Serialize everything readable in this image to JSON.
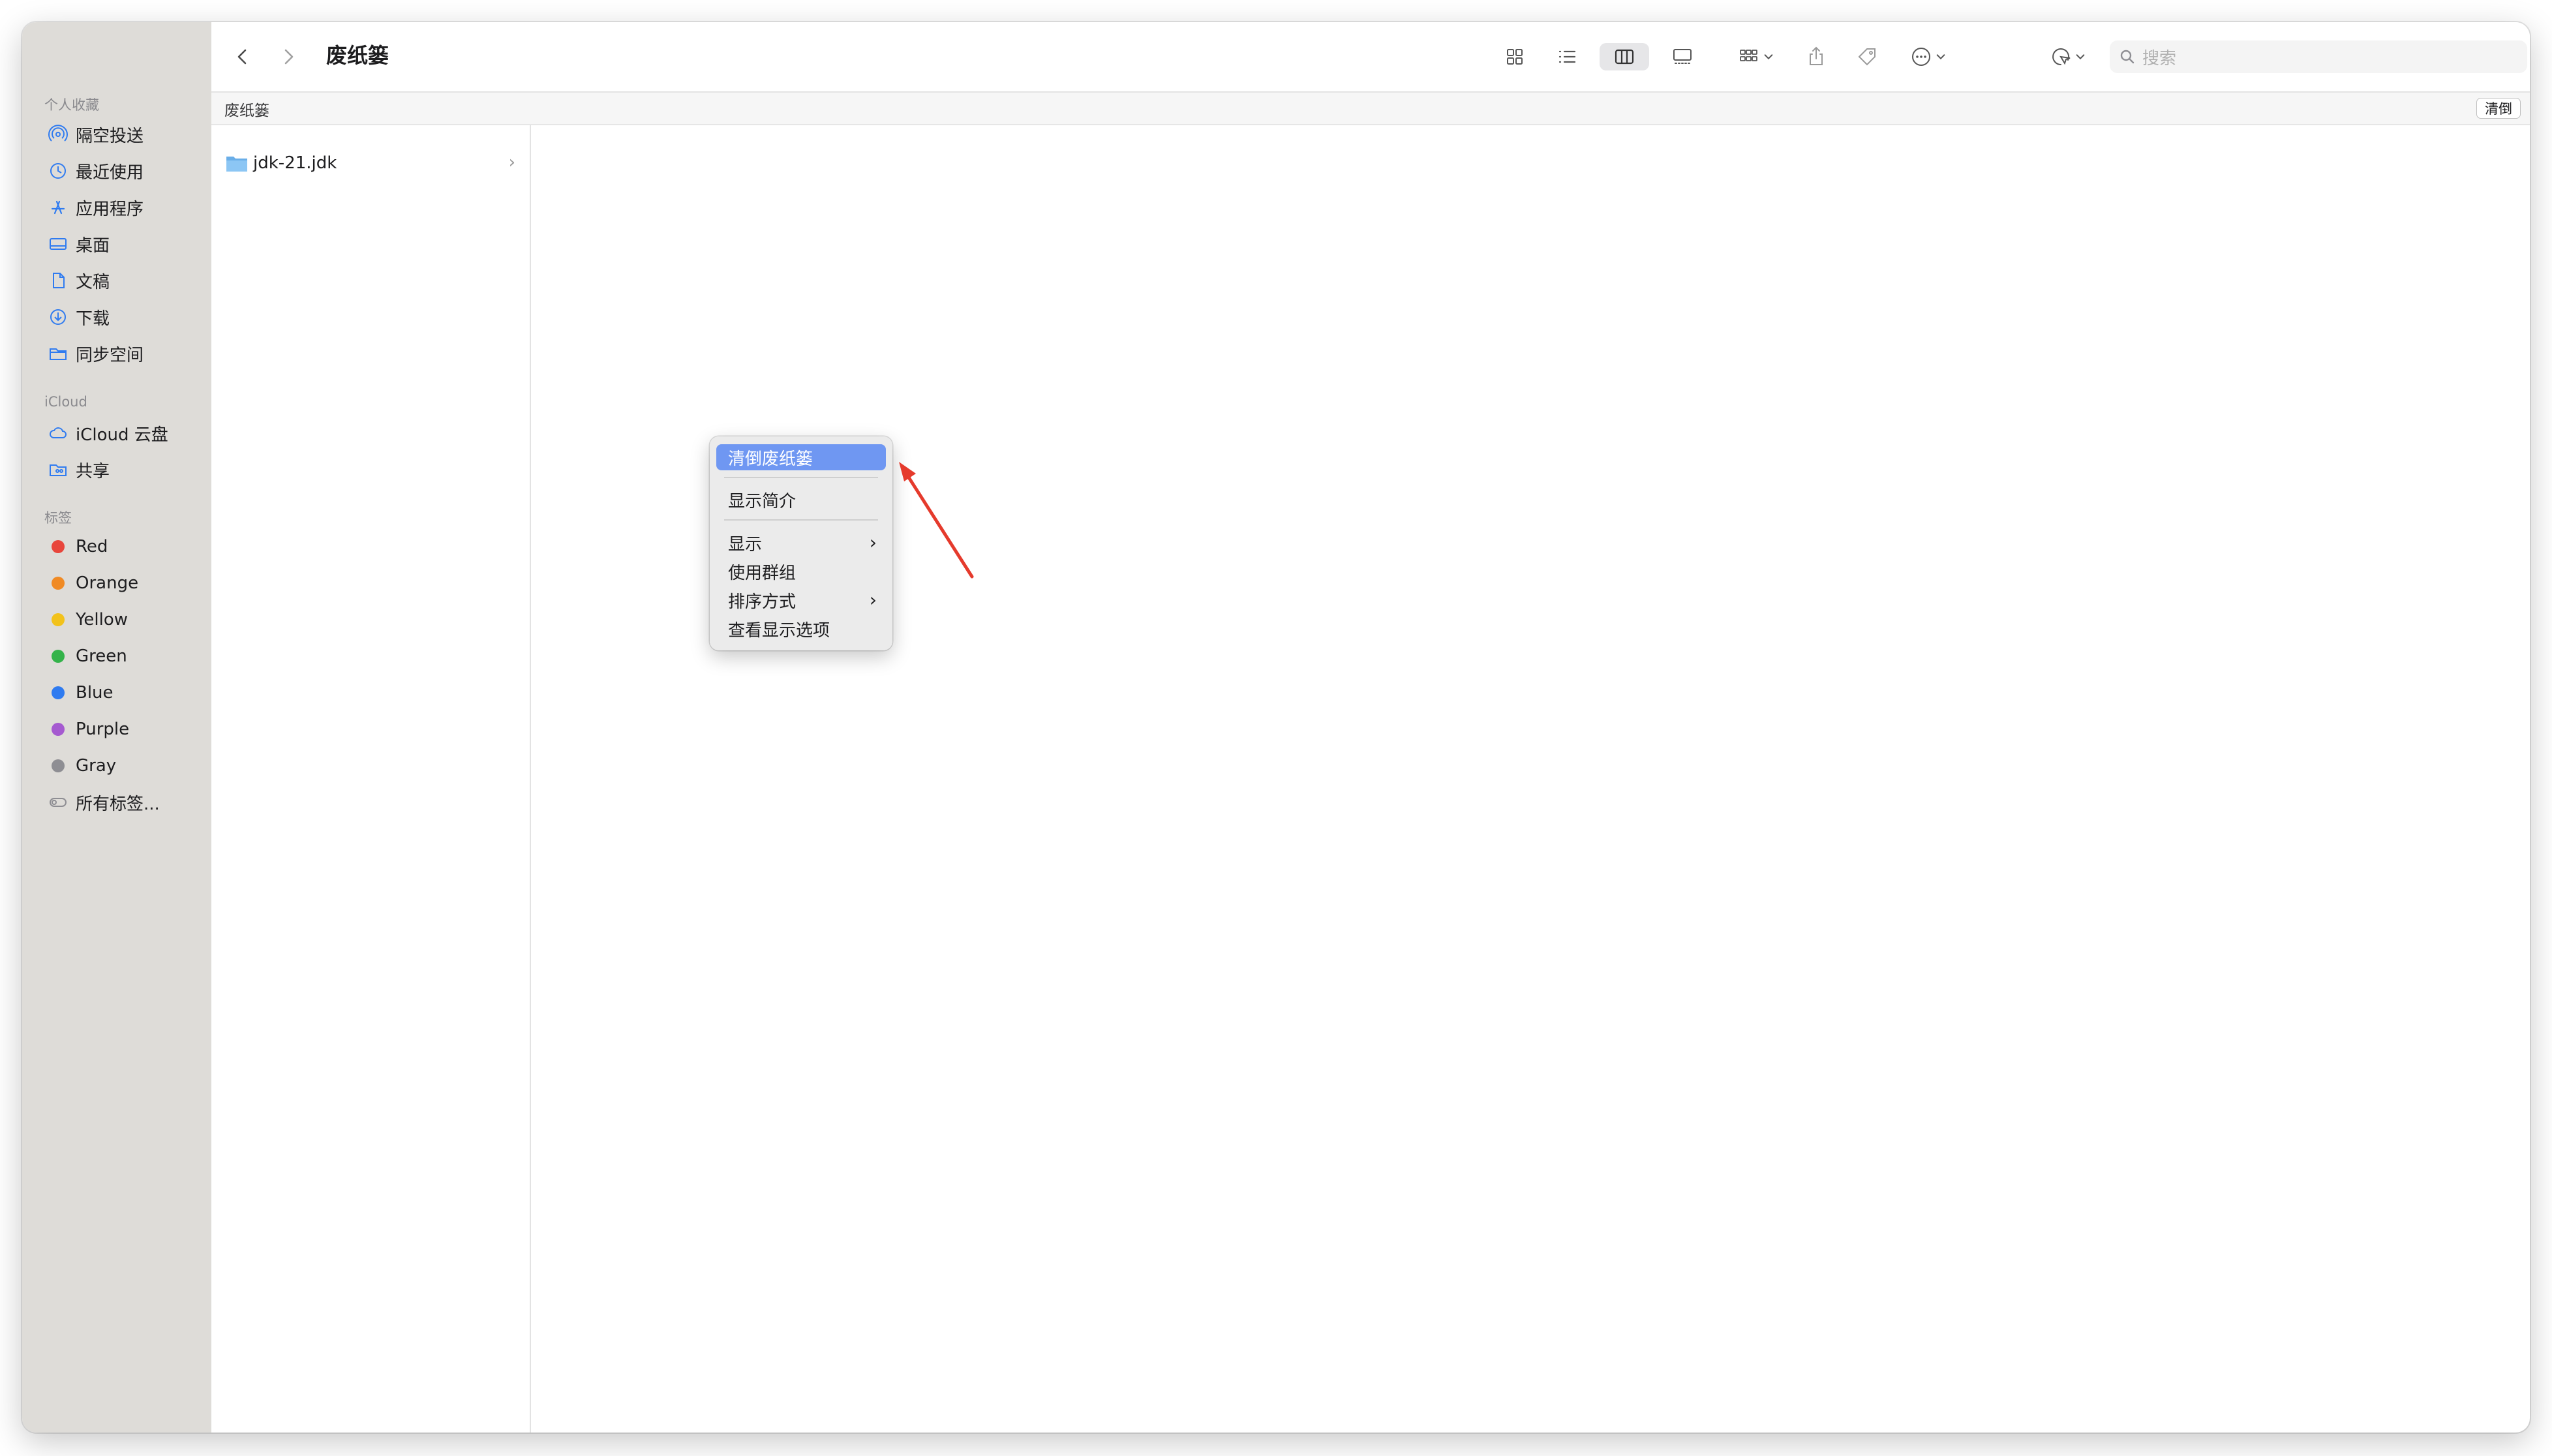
{
  "window": {
    "title": "废纸篓"
  },
  "sidebar": {
    "favorites_header": "个人收藏",
    "favorites": [
      {
        "label": "隔空投送",
        "icon": "airdrop-icon"
      },
      {
        "label": "最近使用",
        "icon": "clock-icon"
      },
      {
        "label": "应用程序",
        "icon": "applications-icon"
      },
      {
        "label": "桌面",
        "icon": "desktop-icon"
      },
      {
        "label": "文稿",
        "icon": "document-icon"
      },
      {
        "label": "下载",
        "icon": "download-icon"
      },
      {
        "label": "同步空间",
        "icon": "folder-icon"
      }
    ],
    "icloud_header": "iCloud",
    "icloud": [
      {
        "label": "iCloud 云盘",
        "icon": "cloud-icon"
      },
      {
        "label": "共享",
        "icon": "shared-folder-icon"
      }
    ],
    "tags_header": "标签",
    "tags": [
      {
        "label": "Red",
        "color": "#e8463c"
      },
      {
        "label": "Orange",
        "color": "#f08a24"
      },
      {
        "label": "Yellow",
        "color": "#f2c21b"
      },
      {
        "label": "Green",
        "color": "#34b34a"
      },
      {
        "label": "Blue",
        "color": "#2f7bf0"
      },
      {
        "label": "Purple",
        "color": "#a55ad0"
      },
      {
        "label": "Gray",
        "color": "#8e8e93"
      }
    ],
    "all_tags_label": "所有标签..."
  },
  "toolbar": {
    "title": "废纸篓",
    "search_placeholder": "搜索",
    "icons": [
      "back-icon",
      "forward-icon",
      "icon-view-icon",
      "list-view-icon",
      "column-view-icon",
      "gallery-view-icon",
      "group-icon",
      "share-icon",
      "tag-icon",
      "more-icon",
      "airdrop-share-icon",
      "search-icon"
    ]
  },
  "pathbar": {
    "crumb": "废纸篓",
    "empty_button": "清倒"
  },
  "files": [
    {
      "name": "jdk-21.jdk",
      "icon": "folder-icon"
    }
  ],
  "context_menu": {
    "items": [
      {
        "label": "清倒废纸篓",
        "highlighted": true
      },
      {
        "label": "显示简介"
      },
      {
        "label": "显示",
        "submenu": true
      },
      {
        "label": "使用群组"
      },
      {
        "label": "排序方式",
        "submenu": true
      },
      {
        "label": "查看显示选项"
      }
    ]
  },
  "colors": {
    "accent": "#6f97f2",
    "sidebar_icon": "#2f7bf0",
    "annotation_arrow": "#e53a2c"
  }
}
